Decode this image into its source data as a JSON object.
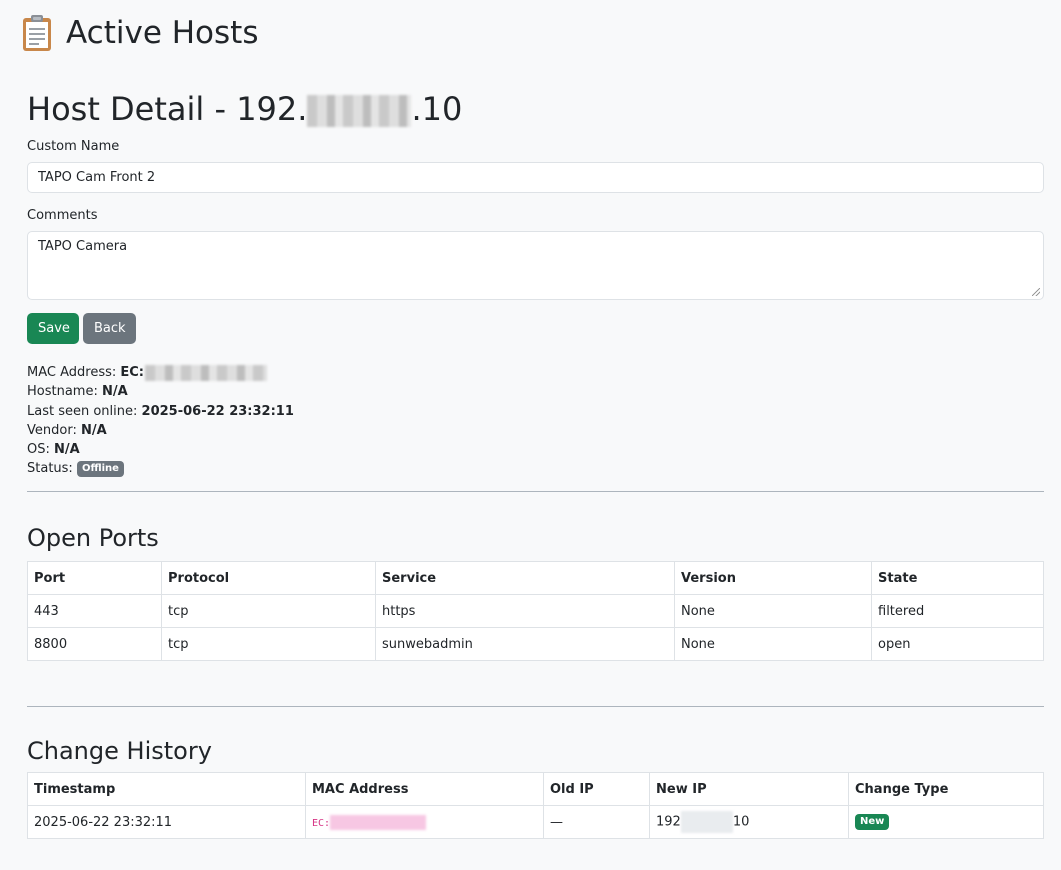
{
  "app": {
    "title": "Active Hosts",
    "icon": "clipboard-icon"
  },
  "host": {
    "title_prefix": "Host Detail - 192.",
    "title_suffix": ".10",
    "custom_name_label": "Custom Name",
    "custom_name_value": "TAPO Cam Front 2",
    "comments_label": "Comments",
    "comments_value": "TAPO Camera",
    "save_label": "Save",
    "back_label": "Back",
    "mac_label": "MAC Address:",
    "mac_value_prefix": "EC:",
    "hostname_label": "Hostname:",
    "hostname_value": "N/A",
    "last_seen_label": "Last seen online:",
    "last_seen_value": "2025-06-22 23:32:11",
    "vendor_label": "Vendor:",
    "vendor_value": "N/A",
    "os_label": "OS:",
    "os_value": "N/A",
    "status_label": "Status:",
    "status_value": "Offline"
  },
  "ports": {
    "heading": "Open Ports",
    "columns": [
      "Port",
      "Protocol",
      "Service",
      "Version",
      "State"
    ],
    "rows": [
      [
        "443",
        "tcp",
        "https",
        "None",
        "filtered"
      ],
      [
        "8800",
        "tcp",
        "sunwebadmin",
        "None",
        "open"
      ]
    ]
  },
  "history": {
    "heading": "Change History",
    "columns": [
      "Timestamp",
      "MAC Address",
      "Old IP",
      "New IP",
      "Change Type"
    ],
    "rows": [
      {
        "timestamp": "2025-06-22 23:32:11",
        "mac_prefix": "EC:",
        "old_ip": "—",
        "new_ip_prefix": "192",
        "new_ip_suffix": "10",
        "change_type": "New"
      }
    ]
  },
  "colors": {
    "success": "#198754",
    "secondary": "#6c757d",
    "code_pink": "#d63384",
    "background": "#f8f9fa"
  }
}
